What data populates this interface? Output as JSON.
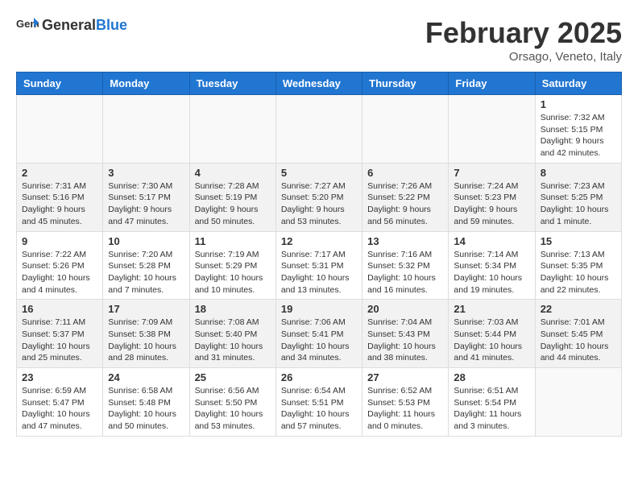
{
  "header": {
    "logo_general": "General",
    "logo_blue": "Blue",
    "month_year": "February 2025",
    "location": "Orsago, Veneto, Italy"
  },
  "weekdays": [
    "Sunday",
    "Monday",
    "Tuesday",
    "Wednesday",
    "Thursday",
    "Friday",
    "Saturday"
  ],
  "weeks": [
    [
      {
        "day": "",
        "info": ""
      },
      {
        "day": "",
        "info": ""
      },
      {
        "day": "",
        "info": ""
      },
      {
        "day": "",
        "info": ""
      },
      {
        "day": "",
        "info": ""
      },
      {
        "day": "",
        "info": ""
      },
      {
        "day": "1",
        "info": "Sunrise: 7:32 AM\nSunset: 5:15 PM\nDaylight: 9 hours and 42 minutes."
      }
    ],
    [
      {
        "day": "2",
        "info": "Sunrise: 7:31 AM\nSunset: 5:16 PM\nDaylight: 9 hours and 45 minutes."
      },
      {
        "day": "3",
        "info": "Sunrise: 7:30 AM\nSunset: 5:17 PM\nDaylight: 9 hours and 47 minutes."
      },
      {
        "day": "4",
        "info": "Sunrise: 7:28 AM\nSunset: 5:19 PM\nDaylight: 9 hours and 50 minutes."
      },
      {
        "day": "5",
        "info": "Sunrise: 7:27 AM\nSunset: 5:20 PM\nDaylight: 9 hours and 53 minutes."
      },
      {
        "day": "6",
        "info": "Sunrise: 7:26 AM\nSunset: 5:22 PM\nDaylight: 9 hours and 56 minutes."
      },
      {
        "day": "7",
        "info": "Sunrise: 7:24 AM\nSunset: 5:23 PM\nDaylight: 9 hours and 59 minutes."
      },
      {
        "day": "8",
        "info": "Sunrise: 7:23 AM\nSunset: 5:25 PM\nDaylight: 10 hours and 1 minute."
      }
    ],
    [
      {
        "day": "9",
        "info": "Sunrise: 7:22 AM\nSunset: 5:26 PM\nDaylight: 10 hours and 4 minutes."
      },
      {
        "day": "10",
        "info": "Sunrise: 7:20 AM\nSunset: 5:28 PM\nDaylight: 10 hours and 7 minutes."
      },
      {
        "day": "11",
        "info": "Sunrise: 7:19 AM\nSunset: 5:29 PM\nDaylight: 10 hours and 10 minutes."
      },
      {
        "day": "12",
        "info": "Sunrise: 7:17 AM\nSunset: 5:31 PM\nDaylight: 10 hours and 13 minutes."
      },
      {
        "day": "13",
        "info": "Sunrise: 7:16 AM\nSunset: 5:32 PM\nDaylight: 10 hours and 16 minutes."
      },
      {
        "day": "14",
        "info": "Sunrise: 7:14 AM\nSunset: 5:34 PM\nDaylight: 10 hours and 19 minutes."
      },
      {
        "day": "15",
        "info": "Sunrise: 7:13 AM\nSunset: 5:35 PM\nDaylight: 10 hours and 22 minutes."
      }
    ],
    [
      {
        "day": "16",
        "info": "Sunrise: 7:11 AM\nSunset: 5:37 PM\nDaylight: 10 hours and 25 minutes."
      },
      {
        "day": "17",
        "info": "Sunrise: 7:09 AM\nSunset: 5:38 PM\nDaylight: 10 hours and 28 minutes."
      },
      {
        "day": "18",
        "info": "Sunrise: 7:08 AM\nSunset: 5:40 PM\nDaylight: 10 hours and 31 minutes."
      },
      {
        "day": "19",
        "info": "Sunrise: 7:06 AM\nSunset: 5:41 PM\nDaylight: 10 hours and 34 minutes."
      },
      {
        "day": "20",
        "info": "Sunrise: 7:04 AM\nSunset: 5:43 PM\nDaylight: 10 hours and 38 minutes."
      },
      {
        "day": "21",
        "info": "Sunrise: 7:03 AM\nSunset: 5:44 PM\nDaylight: 10 hours and 41 minutes."
      },
      {
        "day": "22",
        "info": "Sunrise: 7:01 AM\nSunset: 5:45 PM\nDaylight: 10 hours and 44 minutes."
      }
    ],
    [
      {
        "day": "23",
        "info": "Sunrise: 6:59 AM\nSunset: 5:47 PM\nDaylight: 10 hours and 47 minutes."
      },
      {
        "day": "24",
        "info": "Sunrise: 6:58 AM\nSunset: 5:48 PM\nDaylight: 10 hours and 50 minutes."
      },
      {
        "day": "25",
        "info": "Sunrise: 6:56 AM\nSunset: 5:50 PM\nDaylight: 10 hours and 53 minutes."
      },
      {
        "day": "26",
        "info": "Sunrise: 6:54 AM\nSunset: 5:51 PM\nDaylight: 10 hours and 57 minutes."
      },
      {
        "day": "27",
        "info": "Sunrise: 6:52 AM\nSunset: 5:53 PM\nDaylight: 11 hours and 0 minutes."
      },
      {
        "day": "28",
        "info": "Sunrise: 6:51 AM\nSunset: 5:54 PM\nDaylight: 11 hours and 3 minutes."
      },
      {
        "day": "",
        "info": ""
      }
    ]
  ]
}
